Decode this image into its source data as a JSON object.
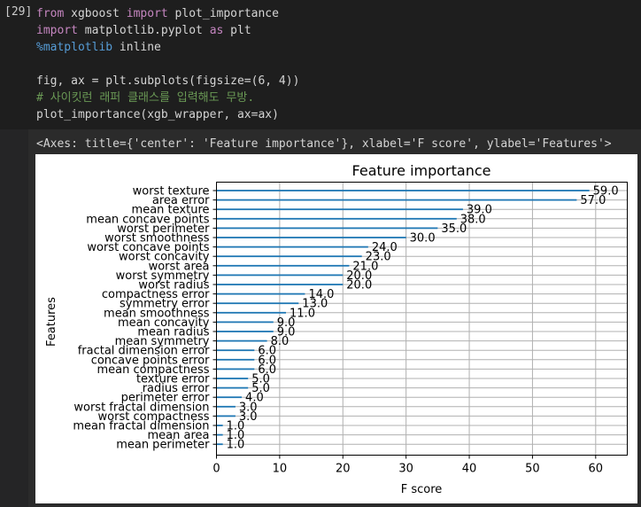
{
  "cell": {
    "prompt": "[29]",
    "lines": [
      [
        {
          "t": "from",
          "c": "kw"
        },
        {
          "t": " xgboost ",
          "c": "tx"
        },
        {
          "t": "import",
          "c": "kw"
        },
        {
          "t": " plot_importance",
          "c": "tx"
        }
      ],
      [
        {
          "t": "import",
          "c": "kw"
        },
        {
          "t": " matplotlib.pyplot ",
          "c": "tx"
        },
        {
          "t": "as",
          "c": "kw"
        },
        {
          "t": " plt",
          "c": "tx"
        }
      ],
      [
        {
          "t": "%matplotlib",
          "c": "mg"
        },
        {
          "t": " inline",
          "c": "tx"
        }
      ],
      [],
      [
        {
          "t": "fig, ax = plt.subplots(figsize=(6, 4))",
          "c": "tx"
        }
      ],
      [
        {
          "t": "# 사이킷런 래퍼 클래스를 입력해도 무방.",
          "c": "cm"
        }
      ],
      [
        {
          "t": "plot_importance(xgb_wrapper, ax=ax)",
          "c": "tx"
        }
      ]
    ]
  },
  "output": {
    "repr": "<Axes: title={'center': 'Feature importance'}, xlabel='F score', ylabel='Features'>"
  },
  "chart_data": {
    "type": "bar",
    "orientation": "horizontal",
    "title": "Feature importance",
    "xlabel": "F score",
    "ylabel": "Features",
    "xlim": [
      0,
      65
    ],
    "xticks": [
      0,
      10,
      20,
      30,
      40,
      50,
      60
    ],
    "grid": true,
    "bar_color": "#1f77b4",
    "categories": [
      "worst texture",
      "area error",
      "mean texture",
      "mean concave points",
      "worst perimeter",
      "worst smoothness",
      "worst concave points",
      "worst concavity",
      "worst area",
      "worst symmetry",
      "worst radius",
      "compactness error",
      "symmetry error",
      "mean smoothness",
      "mean concavity",
      "mean radius",
      "mean symmetry",
      "fractal dimension error",
      "concave points error",
      "mean compactness",
      "texture error",
      "radius error",
      "perimeter error",
      "worst fractal dimension",
      "worst compactness",
      "mean fractal dimension",
      "mean area",
      "mean perimeter"
    ],
    "values": [
      59,
      57,
      39,
      38,
      35,
      30,
      24,
      23,
      21,
      20,
      20,
      14,
      13,
      11,
      9,
      9,
      8,
      6,
      6,
      6,
      5,
      5,
      4,
      3,
      3,
      1,
      1,
      1
    ],
    "value_labels": [
      "59.0",
      "57.0",
      "39.0",
      "38.0",
      "35.0",
      "30.0",
      "24.0",
      "23.0",
      "21.0",
      "20.0",
      "20.0",
      "14.0",
      "13.0",
      "11.0",
      "9.0",
      "9.0",
      "8.0",
      "6.0",
      "6.0",
      "6.0",
      "5.0",
      "5.0",
      "4.0",
      "3.0",
      "3.0",
      "1.0",
      "1.0",
      "1.0"
    ]
  }
}
